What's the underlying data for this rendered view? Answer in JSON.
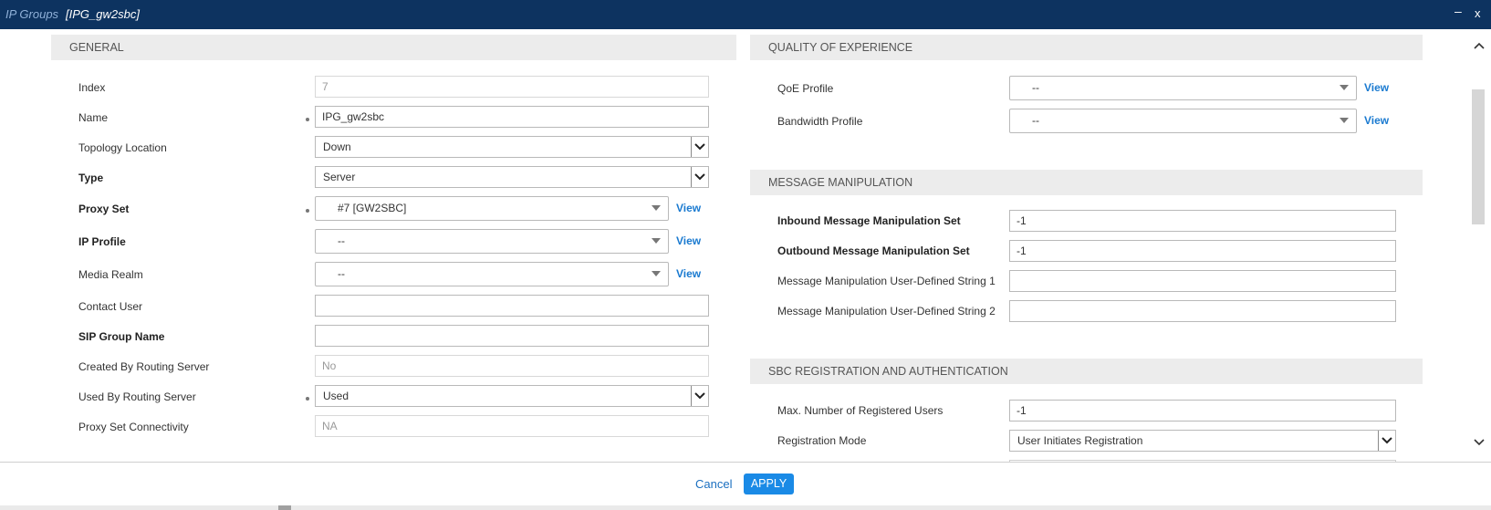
{
  "window": {
    "category": "IP Groups",
    "title": "[IPG_gw2sbc]",
    "minimize_icon": "minimize-icon",
    "close_label": "x"
  },
  "general": {
    "header": "GENERAL",
    "index": {
      "label": "Index",
      "value": "7"
    },
    "name": {
      "label": "Name",
      "value": "IPG_gw2sbc"
    },
    "topology_location": {
      "label": "Topology Location",
      "value": "Down"
    },
    "type": {
      "label": "Type",
      "value": "Server"
    },
    "proxy_set": {
      "label": "Proxy Set",
      "value": "#7 [GW2SBC]",
      "link": "View"
    },
    "ip_profile": {
      "label": "IP Profile",
      "value": "--",
      "link": "View"
    },
    "media_realm": {
      "label": "Media Realm",
      "value": "--",
      "link": "View"
    },
    "contact_user": {
      "label": "Contact User",
      "value": ""
    },
    "sip_group_name": {
      "label": "SIP Group Name",
      "value": ""
    },
    "created_by_routing_server": {
      "label": "Created By Routing Server",
      "value": "No"
    },
    "used_by_routing_server": {
      "label": "Used By Routing Server",
      "value": "Used"
    },
    "proxy_set_connectivity": {
      "label": "Proxy Set Connectivity",
      "value": "NA"
    }
  },
  "qoe": {
    "header": "QUALITY OF EXPERIENCE",
    "qoe_profile": {
      "label": "QoE Profile",
      "value": "--",
      "link": "View"
    },
    "bandwidth_profile": {
      "label": "Bandwidth Profile",
      "value": "--",
      "link": "View"
    }
  },
  "message_manipulation": {
    "header": "MESSAGE MANIPULATION",
    "inbound": {
      "label": "Inbound Message Manipulation Set",
      "value": "-1"
    },
    "outbound": {
      "label": "Outbound Message Manipulation Set",
      "value": "-1"
    },
    "user_string_1": {
      "label": "Message Manipulation User-Defined String 1",
      "value": ""
    },
    "user_string_2": {
      "label": "Message Manipulation User-Defined String 2",
      "value": ""
    }
  },
  "sbc_registration": {
    "header": "SBC REGISTRATION AND AUTHENTICATION",
    "max_registered_users": {
      "label": "Max. Number of Registered Users",
      "value": "-1"
    },
    "registration_mode": {
      "label": "Registration Mode",
      "value": "User Initiates Registration"
    }
  },
  "footer": {
    "cancel_label": "Cancel",
    "apply_label": "APPLY"
  },
  "colors": {
    "titlebar": "#0d3360",
    "accent": "#1a8ae6",
    "link": "#1a7ad0",
    "section_header_bg": "#ececec"
  }
}
